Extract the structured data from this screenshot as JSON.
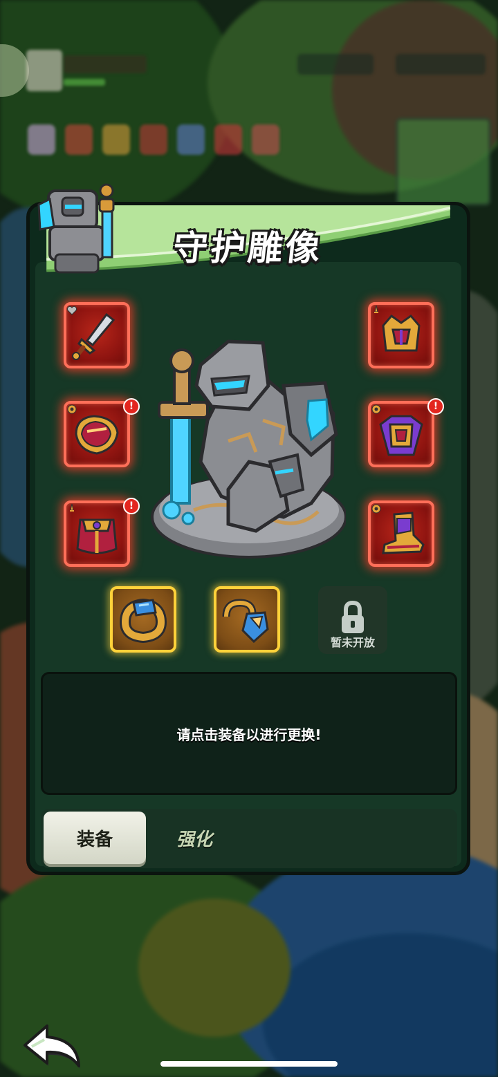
{
  "panel": {
    "title": "守护雕像",
    "slots_left": [
      {
        "name": "sword",
        "badge": false,
        "stat": "heart"
      },
      {
        "name": "shoulder-armor",
        "badge": true,
        "stat": "gear"
      },
      {
        "name": "cape",
        "badge": true,
        "stat": "sword"
      }
    ],
    "slots_right": [
      {
        "name": "helmet",
        "badge": false,
        "stat": "sword"
      },
      {
        "name": "chest-armor",
        "badge": true,
        "stat": "gear"
      },
      {
        "name": "boots",
        "badge": false,
        "stat": "gear"
      }
    ],
    "accessories": [
      {
        "name": "ring"
      },
      {
        "name": "amulet"
      }
    ],
    "locked_label": "暂未开放",
    "badge_symbol": "!",
    "info_text": "请点击装备以进行更换!",
    "tabs": {
      "equip_label": "装备",
      "enhance_label": "强化"
    }
  },
  "colors": {
    "slot_red_border": "#ff6f59",
    "slot_gold_border": "#ffd23a",
    "banner_green": "#8fcf74",
    "panel_bg": "#163826"
  }
}
